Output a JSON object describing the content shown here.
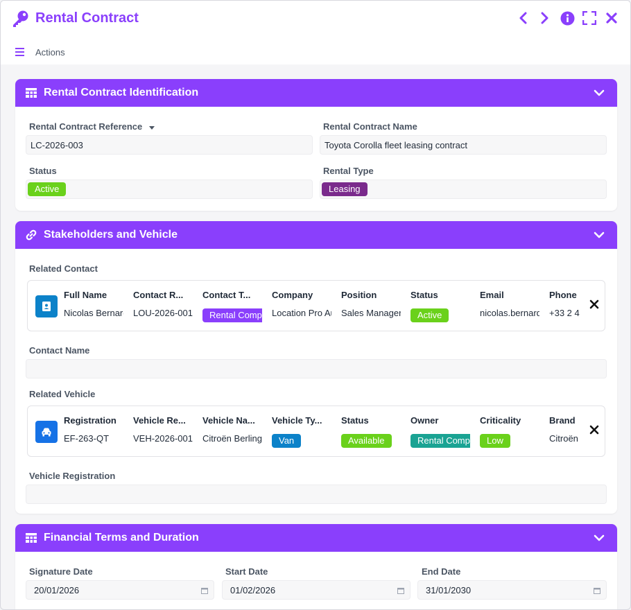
{
  "window": {
    "title": "Rental Contract",
    "accent": "#8a3ffc",
    "controls": [
      "chevron-left-icon",
      "chevron-right-icon",
      "info-icon",
      "fullscreen-icon",
      "close-icon"
    ]
  },
  "actions": {
    "label": "Actions"
  },
  "identification": {
    "title": "Rental Contract Identification",
    "reference_label": "Rental Contract Reference",
    "reference_value": "LC-2026-003",
    "name_label": "Rental Contract Name",
    "name_value": "Toyota Corolla fleet leasing contract",
    "status_label": "Status",
    "status_value": "Active",
    "status_color": "#6ad11b",
    "type_label": "Rental Type",
    "type_value": "Leasing",
    "type_color": "#7a2a8c"
  },
  "stakeholders": {
    "title": "Stakeholders and Vehicle",
    "related_contact_label": "Related Contact",
    "contact": {
      "headers": [
        "Full Name",
        "Contact R...",
        "Contact T...",
        "Company",
        "Position",
        "Status",
        "Email",
        "Phone"
      ],
      "values": [
        "Nicolas Bernard",
        "LOU-2026-001",
        "Rental Company",
        "Location Pro Auto",
        "Sales Manager",
        "Active",
        "nicolas.bernard",
        "+33 2 4"
      ],
      "type_color": "#8a3ffc",
      "status_color": "#6ad11b",
      "icon_color": "#0c82c9"
    },
    "contact_name_label": "Contact Name",
    "contact_name_value": "",
    "related_vehicle_label": "Related Vehicle",
    "vehicle": {
      "headers": [
        "Registration",
        "Vehicle Re...",
        "Vehicle Na...",
        "Vehicle Ty...",
        "Status",
        "Owner",
        "Criticality",
        "Brand"
      ],
      "values": [
        "EF-263-QT",
        "VEH-2026-001",
        "Citroën Berlingo",
        "Van",
        "Available",
        "Rental Company",
        "Low",
        "Citroën"
      ],
      "type_color": "#0c82c9",
      "status_color": "#6ad11b",
      "owner_color": "#1aa393",
      "criticality_color": "#6ad11b",
      "icon_color": "#1672e6"
    },
    "vehicle_registration_label": "Vehicle Registration",
    "vehicle_registration_value": ""
  },
  "financial": {
    "title": "Financial Terms and Duration",
    "signature_label": "Signature Date",
    "signature_value": "20/01/2026",
    "start_label": "Start Date",
    "start_value": "01/02/2026",
    "end_label": "End Date",
    "end_value": "31/01/2030"
  }
}
